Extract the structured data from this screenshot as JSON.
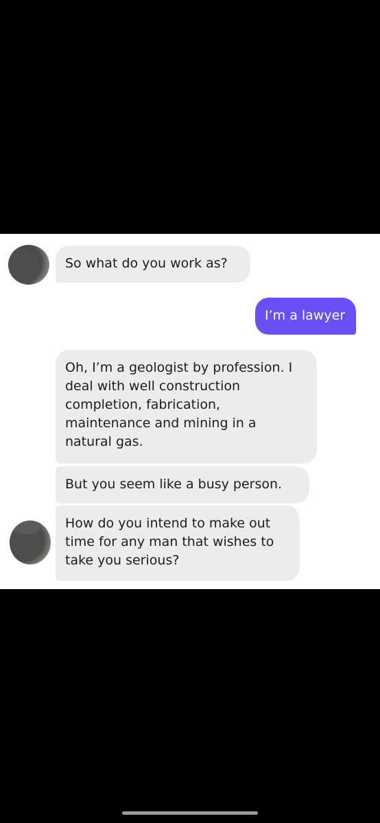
{
  "messages": [
    {
      "sender": "them",
      "text": "So what do you work as?"
    },
    {
      "sender": "me",
      "text": "I’m a lawyer"
    },
    {
      "sender": "them",
      "text": "Oh, I’m a geologist by profession. I\ndeal with well construction\ncompletion, fabrication,\nmaintenance and mining in a\nnatural gas."
    },
    {
      "sender": "them",
      "text": "But you seem like a busy person."
    },
    {
      "sender": "them",
      "text": "How do you intend to make out\ntime for any man that wishes to\ntake you serious?"
    }
  ],
  "colors": {
    "outgoing_bubble": "#6b4ff6",
    "incoming_bubble": "#ececec",
    "background": "#000000"
  }
}
